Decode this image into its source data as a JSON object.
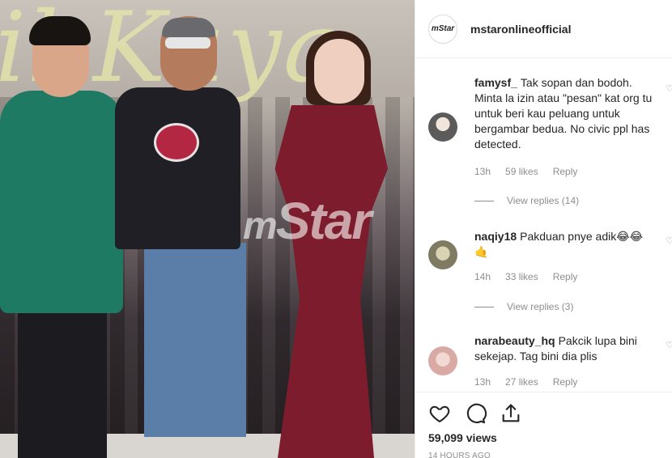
{
  "post": {
    "username": "mstaronlineofficial",
    "avatar_text": "mStar"
  },
  "video": {
    "watermark_m": "m",
    "watermark_star": "Star"
  },
  "comments": [
    {
      "username": "famysf_",
      "text": "Tak sopan dan bodoh. Minta la izin atau \"pesan\" kat org tu untuk beri kau peluang untuk bergambar bedua. No civic ppl has detected.",
      "time": "13h",
      "likes": "59 likes",
      "reply": "Reply",
      "view_replies": "View replies (14)"
    },
    {
      "username": "naqiy18",
      "text": "Pakduan pnye adik😂😂 🤙",
      "time": "14h",
      "likes": "33 likes",
      "reply": "Reply",
      "view_replies": "View replies (3)"
    },
    {
      "username": "narabeauty_hq",
      "text": "Pakcik lupa bini sekejap. Tag bini dia plis",
      "time": "13h",
      "likes": "27 likes",
      "reply": "Reply"
    }
  ],
  "actions": {
    "views": "59,099 views",
    "time_ago": "14 HOURS AGO"
  },
  "icons": [
    "heart-icon",
    "comment-icon",
    "share-icon"
  ]
}
